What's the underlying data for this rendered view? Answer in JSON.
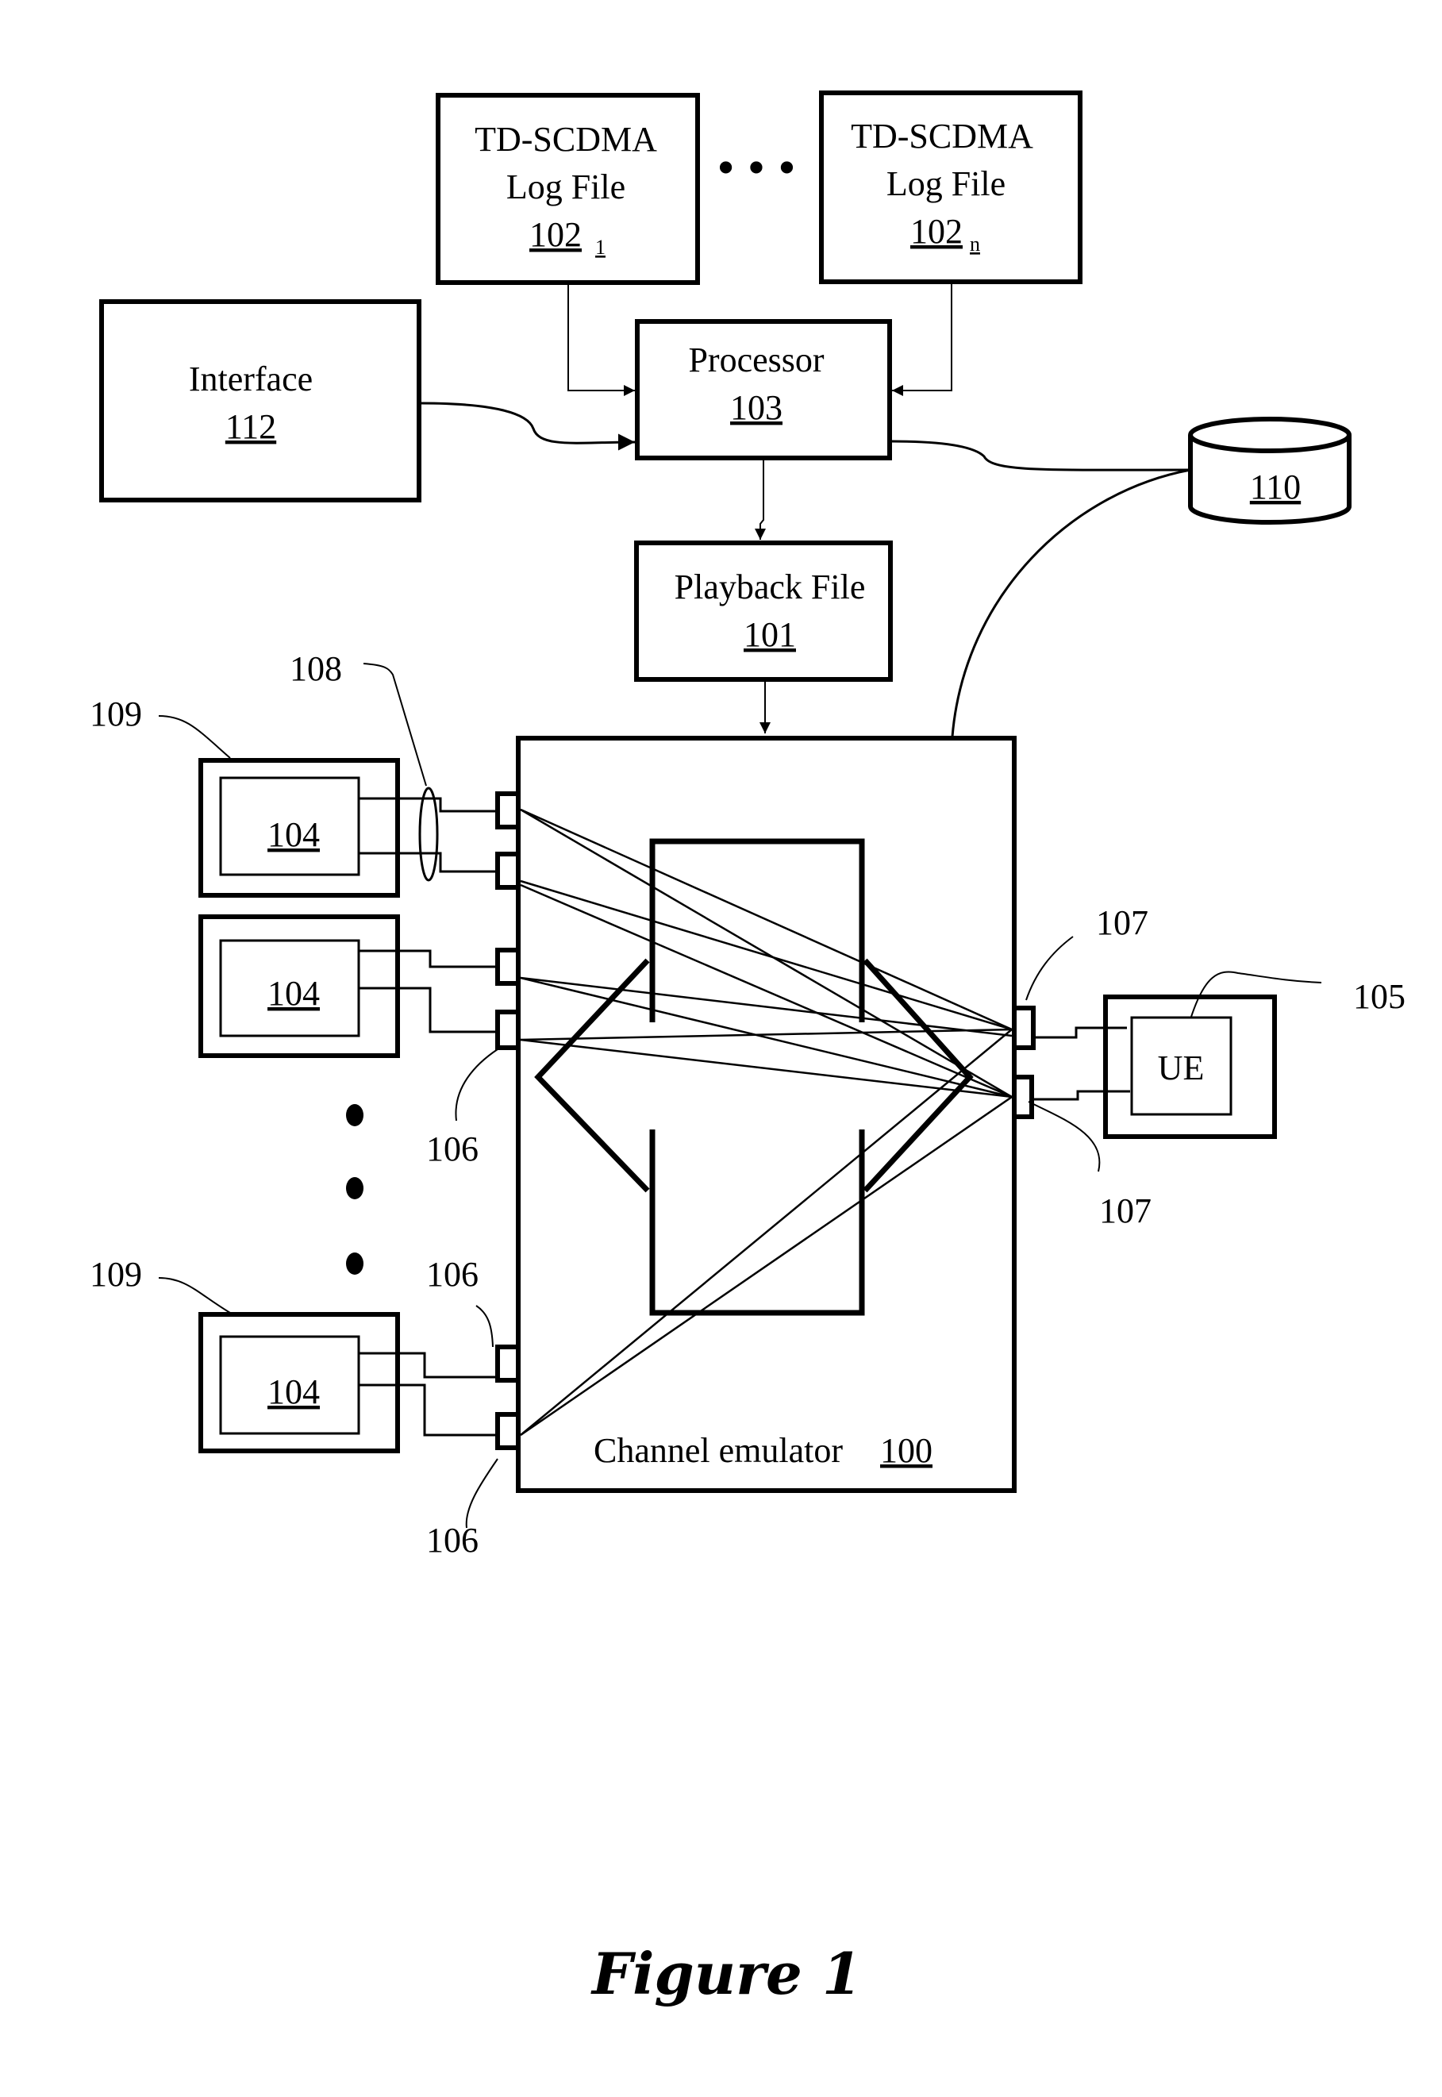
{
  "figure": {
    "caption": "Figure 1"
  },
  "blocks": {
    "log_file_1": {
      "line1": "TD-SCDMA",
      "line2": "Log File",
      "ref": "102",
      "sub": "1"
    },
    "log_file_n": {
      "line1": "TD-SCDMA",
      "line2": "Log File",
      "ref": "102",
      "sub": "n"
    },
    "ellipsis": "• • •",
    "interface": {
      "label": "Interface",
      "ref": "112"
    },
    "processor": {
      "label": "Processor",
      "ref": "103"
    },
    "database": {
      "ref": "110"
    },
    "playback": {
      "label": "Playback File",
      "ref": "101"
    },
    "emulator": {
      "label": "Channel emulator",
      "ref": "100"
    },
    "ue": {
      "label": "UE"
    },
    "base_station_inner": "104"
  },
  "refs": {
    "r108": "108",
    "r109": "109",
    "r106": "106",
    "r107": "107",
    "r105": "105"
  }
}
